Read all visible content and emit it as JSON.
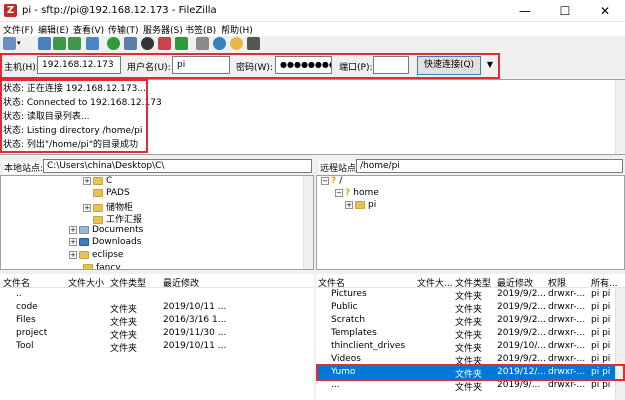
{
  "window": {
    "title": "pi - sftp://pi@192.168.12.173 - FileZilla",
    "app_icon_glyph": "Z",
    "minimize_glyph": "—",
    "maximize_glyph": "☐",
    "close_glyph": "✕"
  },
  "menu": [
    "文件(F)",
    "编辑(E)",
    "查看(V)",
    "传输(T)",
    "服务器(S)",
    "书签(B)",
    "帮助(H)"
  ],
  "quickconnect": {
    "host_label": "主机(H):",
    "host_value": "192.168.12.173",
    "user_label": "用户名(U):",
    "user_value": "pi",
    "password_label": "密码(W):",
    "password_value": "●●●●●●●●●",
    "port_label": "端口(P):",
    "port_value": "",
    "connect_label": "快速连接(Q)",
    "dropdown_glyph": "▼"
  },
  "log": [
    "状态:  正在连接 192.168.12.173...",
    "状态:  Connected to 192.168.12.173",
    "状态:  读取目录列表...",
    "状态:  Listing directory /home/pi",
    "状态:  列出\"/home/pi\"的目录成功"
  ],
  "local": {
    "site_label": "本地站点:",
    "path": "C:\\Users\\china\\Desktop\\C\\",
    "tree": [
      "C",
      "PADS",
      "储物柜",
      "工作汇报",
      "Documents",
      "Downloads",
      "eclipse",
      "fancy"
    ],
    "columns": [
      "文件名",
      "文件大小",
      "文件类型",
      "最近修改"
    ],
    "files": [
      {
        "name": "..",
        "size": "",
        "type": "",
        "modified": ""
      },
      {
        "name": "code",
        "size": "",
        "type": "文件夹",
        "modified": "2019/10/11 ..."
      },
      {
        "name": "Files",
        "size": "",
        "type": "文件夹",
        "modified": "2016/3/16 1..."
      },
      {
        "name": "project",
        "size": "",
        "type": "文件夹",
        "modified": "2019/11/30 ..."
      },
      {
        "name": "Tool",
        "size": "",
        "type": "文件夹",
        "modified": "2019/10/11 ..."
      }
    ]
  },
  "remote": {
    "site_label": "远程站点:",
    "path": "/home/pi",
    "tree": [
      "/",
      "home",
      "pi"
    ],
    "unknown_glyph": "?",
    "columns": [
      "文件名",
      "文件大...",
      "文件类型",
      "最近修改",
      "权限",
      "所有..."
    ],
    "files": [
      {
        "name": "Pictures",
        "size": "",
        "type": "文件夹",
        "modified": "2019/9/2...",
        "perm": "drwxr-...",
        "owner": "pi pi"
      },
      {
        "name": "Public",
        "size": "",
        "type": "文件夹",
        "modified": "2019/9/2...",
        "perm": "drwxr-...",
        "owner": "pi pi"
      },
      {
        "name": "Scratch",
        "size": "",
        "type": "文件夹",
        "modified": "2019/9/2...",
        "perm": "drwxr-...",
        "owner": "pi pi"
      },
      {
        "name": "Templates",
        "size": "",
        "type": "文件夹",
        "modified": "2019/9/2...",
        "perm": "drwxr-...",
        "owner": "pi pi"
      },
      {
        "name": "thinclient_drives",
        "size": "",
        "type": "文件夹",
        "modified": "2019/10/...",
        "perm": "drwxr-...",
        "owner": "pi pi"
      },
      {
        "name": "Videos",
        "size": "",
        "type": "文件夹",
        "modified": "2019/9/2...",
        "perm": "drwxr-...",
        "owner": "pi pi"
      },
      {
        "name": "Yumo",
        "size": "",
        "type": "文件夹",
        "modified": "2019/12/...",
        "perm": "drwxr-...",
        "owner": "pi pi"
      },
      {
        "name": "...",
        "size": "",
        "type": "文件夹",
        "modified": "2019/9/...",
        "perm": "drwxr-...",
        "owner": "pi pi"
      }
    ]
  },
  "colors": {
    "accent": "#0078d7",
    "highlight": "#e32b35",
    "folder": "#e8c15a"
  }
}
